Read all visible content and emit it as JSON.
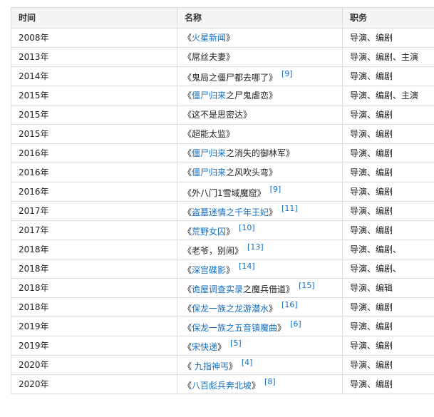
{
  "table": {
    "headers": {
      "year": "时间",
      "title": "名称",
      "role": "职务"
    },
    "rows": [
      {
        "year": "2008年",
        "title_open": "《",
        "title_link": "火星新闻",
        "title_rest": "",
        "title_close": "》",
        "ref": "",
        "role": "导演、编剧"
      },
      {
        "year": "2013年",
        "title_open": "《",
        "title_link": "",
        "title_rest": "屌丝夫妻",
        "title_close": "》",
        "ref": "",
        "role": "导演、编剧、主演"
      },
      {
        "year": "2014年",
        "title_open": "《",
        "title_link": "",
        "title_rest": "鬼局之僵尸都去哪了",
        "title_close": "》",
        "ref": "[9]",
        "role": "导演、编剧"
      },
      {
        "year": "2015年",
        "title_open": "《",
        "title_link": "僵尸归来",
        "title_rest": "之尸鬼虐恋",
        "title_close": "》",
        "ref": "",
        "role": "导演、编剧、主演"
      },
      {
        "year": "2015年",
        "title_open": "《",
        "title_link": "",
        "title_rest": "这不是思密达",
        "title_close": "》",
        "ref": "",
        "role": "导演、编剧"
      },
      {
        "year": "2015年",
        "title_open": "《",
        "title_link": "",
        "title_rest": "超能太监",
        "title_close": "》",
        "ref": "",
        "role": "导演、编剧"
      },
      {
        "year": "2016年",
        "title_open": "《",
        "title_link": "僵尸归来",
        "title_rest": "之消失的御林军",
        "title_close": "》",
        "ref": "",
        "role": "导演、编剧"
      },
      {
        "year": "2016年",
        "title_open": "《",
        "title_link": "僵尸归来",
        "title_rest": "之风吹头弯",
        "title_close": "》",
        "ref": "",
        "role": "导演、编剧"
      },
      {
        "year": "2016年",
        "title_open": "《",
        "title_link": "",
        "title_rest": "外八门1雪域魔窟",
        "title_close": "》",
        "ref": "[9]",
        "role": "导演、编剧"
      },
      {
        "year": "2017年",
        "title_open": "《",
        "title_link": "盗墓迷情之千年王妃",
        "title_rest": "",
        "title_close": "》",
        "ref": "[11]",
        "role": "导演、编剧"
      },
      {
        "year": "2017年",
        "title_open": "《",
        "title_link": "荒野女囚",
        "title_rest": "",
        "title_close": "》",
        "ref": "[10]",
        "role": "导演、编剧"
      },
      {
        "year": "2018年",
        "title_open": "《",
        "title_link": "",
        "title_rest": "老爷，别闹",
        "title_close": "》",
        "ref": "[13]",
        "role": "导演、编剧、"
      },
      {
        "year": "2018年",
        "title_open": "《",
        "title_link": "深宫碟影",
        "title_rest": "",
        "title_close": "》",
        "ref": "[14]",
        "role": "导演、编剧、"
      },
      {
        "year": "2018年",
        "title_open": "《",
        "title_link": "诡屋调查实录",
        "title_rest": "之魔兵借道",
        "title_close": "》",
        "ref": "[15]",
        "role": "导演、编辑"
      },
      {
        "year": "2018年",
        "title_open": "《",
        "title_link": "保龙一族之龙游潜水",
        "title_rest": "",
        "title_close": "》",
        "ref": "[16]",
        "role": "导演、编剧"
      },
      {
        "year": "2019年",
        "title_open": "《",
        "title_link": "保龙一族之五音镇魔曲",
        "title_rest": "",
        "title_close": "》",
        "ref": "[6]",
        "role": "导演、编剧"
      },
      {
        "year": "2019年",
        "title_open": "《",
        "title_link": "宋快递",
        "title_rest": "",
        "title_close": "》",
        "ref": "[5]",
        "role": "导演、编剧"
      },
      {
        "year": "2020年",
        "title_open": "《 ",
        "title_link": "九指神丐",
        "title_rest": "",
        "title_close": "》",
        "ref": "[4]",
        "role": "导演、编剧"
      },
      {
        "year": "2020年",
        "title_open": "《",
        "title_link": "八百彪兵奔北坡",
        "title_rest": "",
        "title_close": "》",
        "ref": "[8]",
        "role": "导演、编剧"
      }
    ]
  },
  "colors": {
    "link": "#136ec2",
    "border": "#dcdcdc",
    "header_bg": "#f5f5f5"
  }
}
